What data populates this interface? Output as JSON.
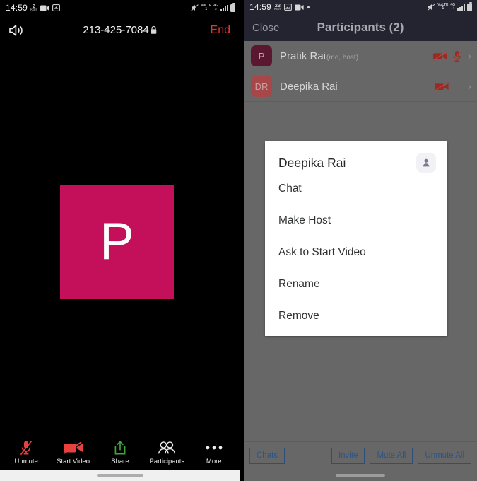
{
  "left_panel": {
    "status_bar": {
      "time": "14:59",
      "data_rate_value": "2",
      "data_rate_unit": "KB/s",
      "icons": [
        "video-recording-icon",
        "screen-cast-icon"
      ],
      "right_icons": [
        "mute-bell-icon",
        "volte-icon",
        "network-4g-lte-icon",
        "signal-bars-icon",
        "battery-icon"
      ],
      "volte_label": "VoLTE1",
      "network_label": "4G"
    },
    "call_bar": {
      "speaker_icon": "speaker-on-icon",
      "phone_number": "213-425-7084",
      "lock_icon": "lock-icon",
      "end_label": "End",
      "end_color": "#e8332b"
    },
    "stage": {
      "avatar_initial": "P",
      "avatar_color": "#c4105a"
    },
    "toolbar": [
      {
        "label": "Unmute",
        "icon": "microphone-muted-icon"
      },
      {
        "label": "Start Video",
        "icon": "video-off-icon"
      },
      {
        "label": "Share",
        "icon": "share-upload-icon"
      },
      {
        "label": "Participants",
        "icon": "participants-icon"
      },
      {
        "label": "More",
        "icon": "more-dots-icon"
      }
    ]
  },
  "right_panel": {
    "status_bar": {
      "time": "14:59",
      "data_rate_value": "23",
      "data_rate_unit": "KB/s",
      "icons": [
        "image-icon",
        "video-recording-icon",
        "dot-icon"
      ],
      "volte_label": "VoLTE1",
      "network_label": "4G"
    },
    "header": {
      "close_label": "Close",
      "title": "Participants (2)"
    },
    "participants": [
      {
        "initials": "P",
        "name": "Pratik Rai",
        "subtitle": "(me, host)",
        "avatar_color": "#5c1730",
        "icons": [
          "video-off-icon",
          "microphone-muted-icon"
        ],
        "chevron": "chevron-right-icon"
      },
      {
        "initials": "DR",
        "name": "Deepika Rai",
        "subtitle": "",
        "avatar_color": "#a8474a",
        "icons": [
          "video-off-icon"
        ],
        "chevron": "chevron-right-icon"
      }
    ],
    "dialog": {
      "name": "Deepika Rai",
      "profile_icon": "person-icon",
      "options": [
        "Chat",
        "Make Host",
        "Ask to Start Video",
        "Rename",
        "Remove"
      ]
    },
    "bottom_bar": {
      "chats_label": "Chats",
      "invite_label": "Invite",
      "mute_all_label": "Mute All",
      "unmute_all_label": "Unmute All",
      "button_color": "#2c5488"
    }
  }
}
